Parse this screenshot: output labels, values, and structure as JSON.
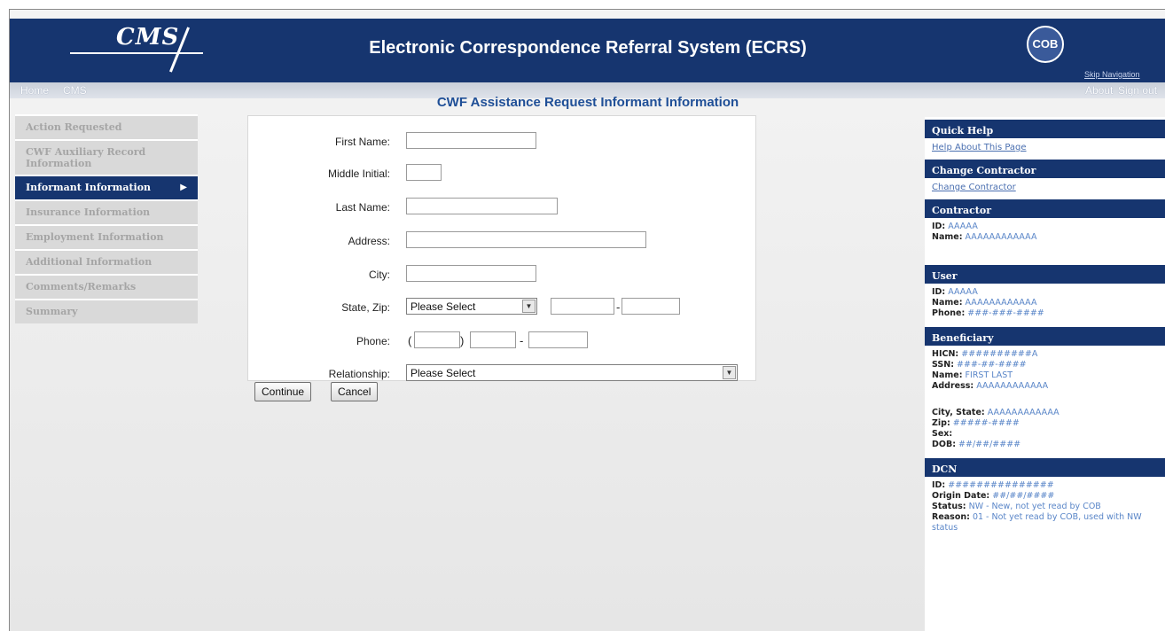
{
  "header": {
    "logo_text": "CMS",
    "app_title": "Electronic Correspondence Referral System (ECRS)",
    "badge_text": "COB",
    "skip_nav": "Skip Navigation"
  },
  "nav": {
    "home": "Home",
    "cms": "CMS",
    "about": "About",
    "signout": "Sign out"
  },
  "page_title": "CWF Assistance Request Informant Information",
  "leftnav": {
    "items": [
      {
        "label": "Action Requested"
      },
      {
        "label": "CWF Auxiliary Record Information"
      },
      {
        "label": "Informant Information",
        "active_arrow": "▶"
      },
      {
        "label": "Insurance Information"
      },
      {
        "label": "Employment Information"
      },
      {
        "label": "Additional Information"
      },
      {
        "label": "Comments/Remarks"
      },
      {
        "label": "Summary"
      }
    ]
  },
  "form": {
    "first_name_label": "First Name:",
    "first_name_value": "",
    "middle_initial_label": "Middle Initial:",
    "middle_initial_value": "",
    "last_name_label": "Last Name:",
    "last_name_value": "",
    "address_label": "Address:",
    "address_value": "",
    "city_label": "City:",
    "city_value": "",
    "state_zip_label": "State, Zip:",
    "state_selected": "Please Select",
    "zip_value": "",
    "zip_ext_value": "",
    "zip_dash": "-",
    "phone_label": "Phone:",
    "phone_open": "(",
    "phone_close": ")",
    "phone_dash": "-",
    "relationship_label": "Relationship:",
    "relationship_selected": "Please Select",
    "continue_label": "Continue",
    "cancel_label": "Cancel"
  },
  "sidebar": {
    "quick_help": {
      "title": "Quick Help",
      "link": "Help About This Page"
    },
    "change_contractor": {
      "title": "Change Contractor",
      "link": "Change Contractor"
    },
    "contractor": {
      "title": "Contractor",
      "id_label": "ID:",
      "id_value": "AAAAA",
      "name_label": "Name:",
      "name_value": "AAAAAAAAAAAA"
    },
    "user": {
      "title": "User",
      "id_label": "ID:",
      "id_value": "AAAAA",
      "name_label": "Name:",
      "name_value": "AAAAAAAAAAAA",
      "phone_label": "Phone:",
      "phone_value": "###-###-####"
    },
    "beneficiary": {
      "title": "Beneficiary",
      "hicn_label": "HICN:",
      "hicn_value": "##########A",
      "ssn_label": "SSN:",
      "ssn_value": "###-##-####",
      "name_label": "Name:",
      "name_value": "FIRST LAST",
      "address_label": "Address:",
      "address_value": "AAAAAAAAAAAA",
      "city_label": "City, State:",
      "city_value": "AAAAAAAAAAAA",
      "zip_label": "Zip:",
      "zip_value": "#####-####",
      "sex_label": "Sex:",
      "sex_value": "",
      "dob_label": "DOB:",
      "dob_value": "##/##/####"
    },
    "dcn": {
      "title": "DCN",
      "id_label": "ID:",
      "id_value": "###############",
      "origin_label": "Origin Date:",
      "origin_value": "##/##/####",
      "status_label": "Status:",
      "status_value": "NW - New, not yet read by COB",
      "reason_label": "Reason:",
      "reason_value": "01 - Not yet read by COB, used with NW status"
    }
  },
  "colors": {
    "header_bg": "#16356f",
    "title_blue": "#1f4f97",
    "link_blue": "#5a86c8",
    "nav_disabled": "#a5a5a5"
  }
}
